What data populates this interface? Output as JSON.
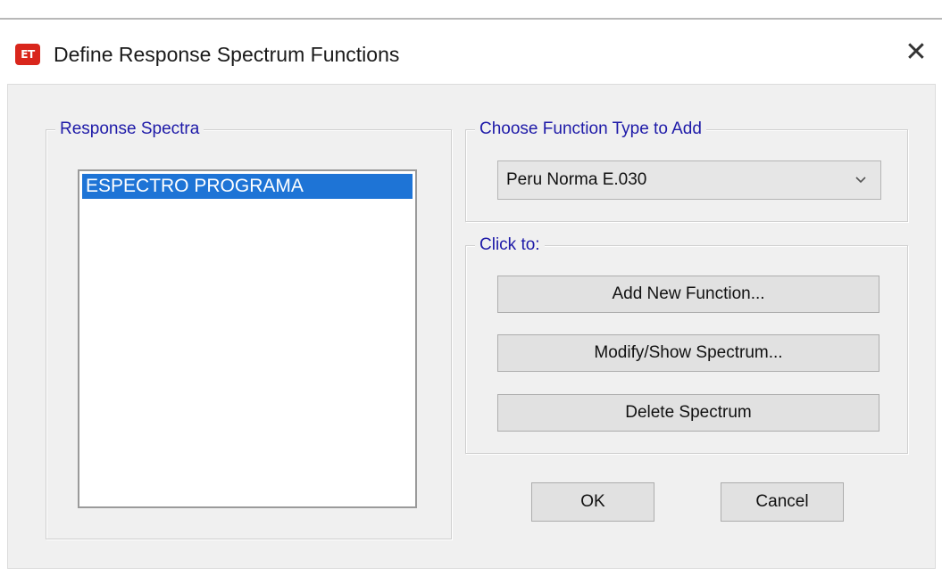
{
  "window": {
    "title": "Define Response Spectrum Functions",
    "app_icon_text": "ET",
    "close_glyph": "✕"
  },
  "response_spectra": {
    "label": "Response Spectra",
    "items": [
      "ESPECTRO PROGRAMA"
    ],
    "selected": "ESPECTRO PROGRAMA"
  },
  "function_type": {
    "label": "Choose  Function Type to Add",
    "selected_value": "Peru Norma E.030"
  },
  "actions": {
    "label": "Click to:",
    "add_new": "Add New Function...",
    "modify_show": "Modify/Show Spectrum...",
    "delete": "Delete Spectrum"
  },
  "footer": {
    "ok": "OK",
    "cancel": "Cancel"
  },
  "colors": {
    "selection": "#1e74d6",
    "group_label": "#1e1aa8",
    "app_icon": "#d9261c"
  },
  "icons": {
    "app": "etabs-app-icon",
    "close": "close-icon",
    "dropdown": "chevron-down-icon"
  }
}
